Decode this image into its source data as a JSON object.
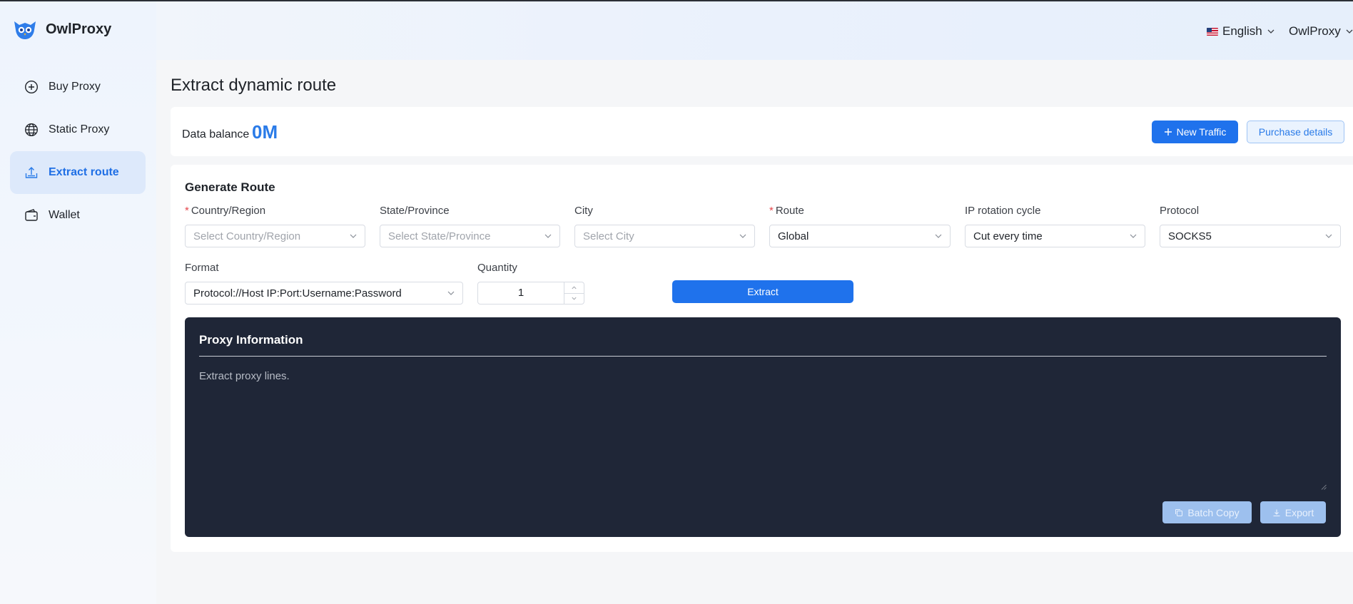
{
  "brand": {
    "name": "OwlProxy"
  },
  "sidebar": {
    "items": [
      {
        "label": "Buy Proxy",
        "icon": "plus-circle-icon",
        "active": false
      },
      {
        "label": "Static Proxy",
        "icon": "globe-icon",
        "active": false
      },
      {
        "label": "Extract route",
        "icon": "upload-tray-icon",
        "active": true
      },
      {
        "label": "Wallet",
        "icon": "wallet-icon",
        "active": false
      }
    ]
  },
  "header": {
    "language": "English",
    "language_icon": "us-flag-icon",
    "user": "OwlProxy"
  },
  "page": {
    "title": "Extract dynamic route"
  },
  "balance": {
    "label": "Data balance",
    "value": "0M",
    "new_traffic_label": "New Traffic",
    "purchase_details_label": "Purchase details"
  },
  "route": {
    "title": "Generate Route",
    "fields": {
      "country": {
        "label": "Country/Region",
        "required": true,
        "placeholder": "Select Country/Region",
        "value": ""
      },
      "state": {
        "label": "State/Province",
        "required": false,
        "placeholder": "Select State/Province",
        "value": ""
      },
      "city": {
        "label": "City",
        "required": false,
        "placeholder": "Select City",
        "value": ""
      },
      "route": {
        "label": "Route",
        "required": true,
        "value": "Global"
      },
      "rotation": {
        "label": "IP rotation cycle",
        "required": false,
        "value": "Cut every time"
      },
      "protocol": {
        "label": "Protocol",
        "required": false,
        "value": "SOCKS5"
      },
      "format": {
        "label": "Format",
        "required": false,
        "value": "Protocol://Host IP:Port:Username:Password"
      },
      "quantity": {
        "label": "Quantity",
        "value": "1"
      }
    },
    "extract_label": "Extract"
  },
  "proxy_info": {
    "title": "Proxy Information",
    "placeholder": "Extract proxy lines.",
    "batch_copy_label": "Batch Copy",
    "export_label": "Export"
  },
  "colors": {
    "accent": "#1f72ec",
    "balance": "#2a7be8",
    "panel_bg": "#1f2637",
    "required": "#e5484d"
  }
}
